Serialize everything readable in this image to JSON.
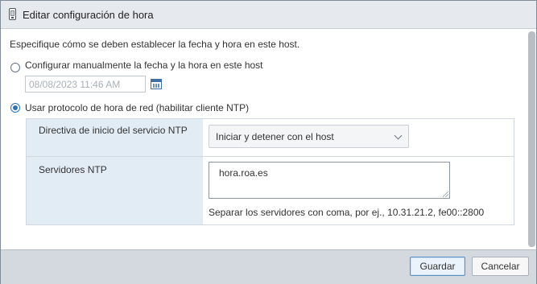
{
  "dialog": {
    "title": "Editar configuración de hora",
    "title_icon": "host-icon"
  },
  "intro": "Especifique cómo se deben establecer la fecha y hora en este host.",
  "options": {
    "manual": {
      "label": "Configurar manualmente la fecha y la hora en este host",
      "selected": false,
      "datetime_value": "08/08/2023 11:46 AM",
      "calendar_icon": "calendar-icon"
    },
    "ntp": {
      "label": "Usar protocolo de hora de red (habilitar cliente NTP)",
      "selected": true
    }
  },
  "ntp_settings": {
    "startup_policy": {
      "label": "Directiva de inicio del servicio NTP",
      "value": "Iniciar y detener con el host"
    },
    "servers": {
      "label": "Servidores NTP",
      "value": "hora.roa.es",
      "hint": "Separar los servidores con coma, por ej., 10.31.21.2, fe00::2800"
    }
  },
  "footer": {
    "save_label": "Guardar",
    "cancel_label": "Cancelar"
  },
  "colors": {
    "accent": "#2b73b7",
    "label_column_bg": "#e2ecf5",
    "footer_bg": "#d4d9df"
  }
}
